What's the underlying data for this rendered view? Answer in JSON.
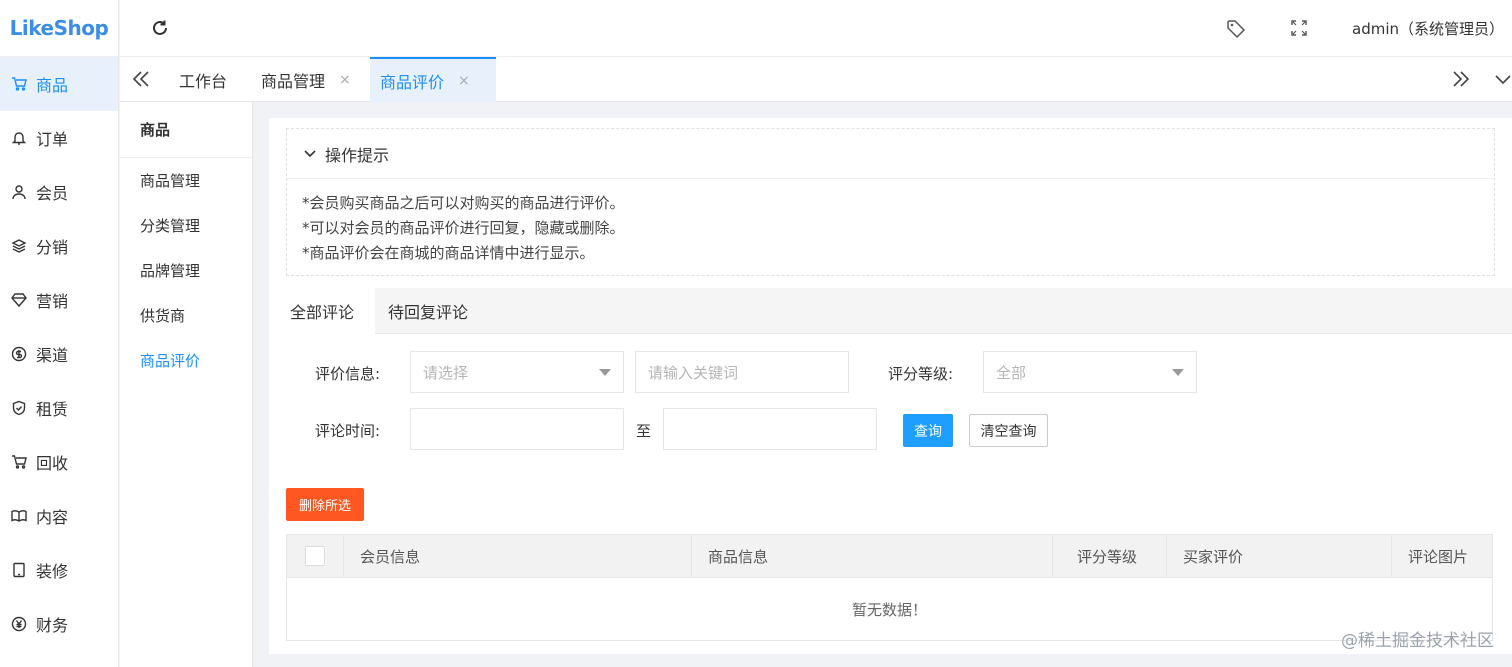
{
  "brand": {
    "logo_text": "LikeShop"
  },
  "header": {
    "user_label": "admin（系统管理员）"
  },
  "sidebar": {
    "items": [
      {
        "label": "商品",
        "icon": "cart-icon"
      },
      {
        "label": "订单",
        "icon": "bell-icon"
      },
      {
        "label": "会员",
        "icon": "user-icon"
      },
      {
        "label": "分销",
        "icon": "layers-icon"
      },
      {
        "label": "营销",
        "icon": "diamond-icon"
      },
      {
        "label": "渠道",
        "icon": "dollar-icon"
      },
      {
        "label": "租赁",
        "icon": "shield-check-icon"
      },
      {
        "label": "回收",
        "icon": "cart-icon"
      },
      {
        "label": "内容",
        "icon": "book-icon"
      },
      {
        "label": "装修",
        "icon": "tablet-icon"
      },
      {
        "label": "财务",
        "icon": "yen-icon"
      }
    ],
    "active_index": 0
  },
  "tabs": {
    "items": [
      {
        "label": "工作台",
        "closable": false
      },
      {
        "label": "商品管理",
        "closable": true
      },
      {
        "label": "商品评价",
        "closable": true
      }
    ],
    "active_index": 2,
    "close_glyph": "×"
  },
  "submenu": {
    "title": "商品",
    "items": [
      "商品管理",
      "分类管理",
      "品牌管理",
      "供货商",
      "商品评价"
    ],
    "active_index": 4
  },
  "tips": {
    "title": "操作提示",
    "lines": [
      "*会员购买商品之后可以对购买的商品进行评价。",
      "*可以对会员的商品评价进行回复，隐藏或删除。",
      "*商品评价会在商城的商品详情中进行显示。"
    ]
  },
  "review_tabs": {
    "items": [
      "全部评论",
      "待回复评论"
    ],
    "active_index": 0
  },
  "filters": {
    "review_info_label": "评价信息:",
    "review_info_select_placeholder": "请选择",
    "keyword_placeholder": "请输入关键词",
    "rating_label": "评分等级:",
    "rating_select_value": "全部",
    "time_label": "评论时间:",
    "time_separator": "至",
    "start_time_value": "",
    "end_time_value": "",
    "query_button": "查询",
    "clear_button": "清空查询"
  },
  "actions": {
    "delete_selected": "删除所选"
  },
  "table": {
    "columns": [
      "会员信息",
      "商品信息",
      "评分等级",
      "买家评价",
      "评论图片"
    ],
    "rows": [],
    "empty_text": "暂无数据！"
  },
  "watermark": "@稀土掘金技术社区",
  "colors": {
    "primary": "#1890ff",
    "query_button": "#1e9fff",
    "danger_button": "#ff5722",
    "active_bg": "#e8f1fb"
  }
}
